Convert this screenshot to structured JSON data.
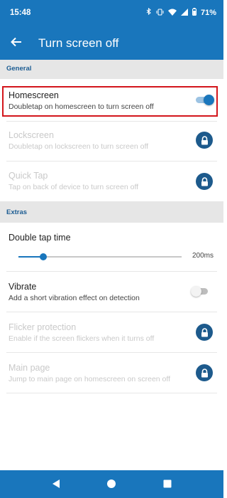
{
  "status_bar": {
    "time": "15:48",
    "battery": "71%"
  },
  "app_bar": {
    "title": "Turn screen off"
  },
  "sections": {
    "general": "General",
    "extras": "Extras"
  },
  "general_items": [
    {
      "title": "Homescreen",
      "subtitle": "Doubletap on homescreen to turn screen off",
      "enabled": true,
      "control": "switch",
      "switch_on": true
    },
    {
      "title": "Lockscreen",
      "subtitle": "Doubletap on lockscreen to turn screen off",
      "enabled": false,
      "control": "lock"
    },
    {
      "title": "Quick Tap",
      "subtitle": "Tap on back of device to turn screen off",
      "enabled": false,
      "control": "lock"
    }
  ],
  "extras": {
    "double_tap": {
      "title": "Double tap time",
      "value_label": "200ms",
      "fraction": 0.15
    },
    "items": [
      {
        "title": "Vibrate",
        "subtitle": "Add a short vibration effect on detection",
        "enabled": true,
        "control": "switch",
        "switch_on": false
      },
      {
        "title": "Flicker protection",
        "subtitle": "Enable if the screen flickers when it turns off",
        "enabled": false,
        "control": "lock"
      },
      {
        "title": "Main page",
        "subtitle": "Jump to main page on homescreen on screen off",
        "enabled": false,
        "control": "lock"
      }
    ]
  },
  "icons": {
    "back": "arrow-left-icon",
    "lock": "lock-icon",
    "nav_back": "triangle-back-icon",
    "nav_home": "circle-home-icon",
    "nav_recents": "square-recents-icon"
  },
  "colors": {
    "primary": "#1976bc",
    "lock_badge": "#1d5a8c",
    "highlight": "#d3161c",
    "section_bg": "#e6e6e6"
  }
}
